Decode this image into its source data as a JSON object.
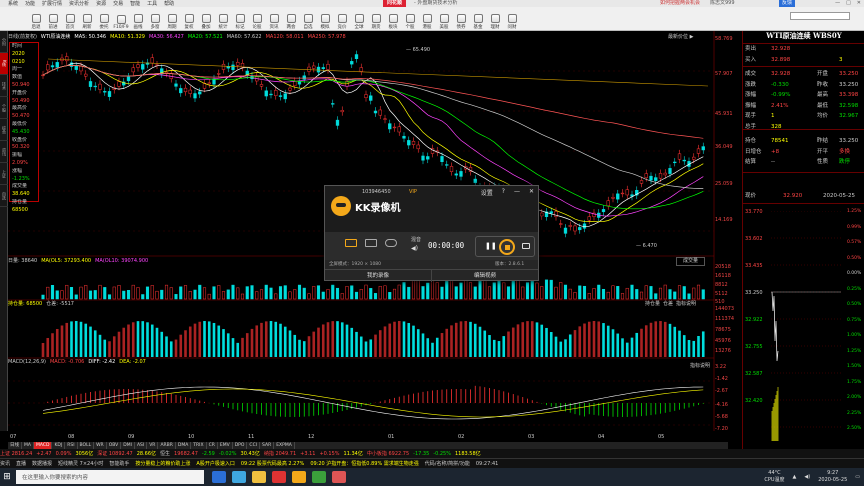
{
  "title_bar": {
    "menus": [
      "系统",
      "功能",
      "扩展行情",
      "资讯分析",
      "资源",
      "交易",
      "智能",
      "工具",
      "帮助"
    ],
    "brand": "同花顺",
    "subtitle": "- 外盘期货技术分析",
    "promo": "如何把握两会机会",
    "user": "陈志文999",
    "feedback": "反馈",
    "window_buttons": [
      "—",
      "□",
      "✕"
    ]
  },
  "toolbar": {
    "buttons": [
      "后退",
      "前进",
      "首页",
      "刷新",
      "委托",
      "F10/F9",
      "画线",
      "多窗",
      "周期",
      "复权",
      "叠加",
      "统计",
      "标记",
      "论股",
      "资讯",
      "两会",
      "自选",
      "模拟",
      "竞价",
      "全球",
      "期货",
      "板块",
      "个股",
      "港股",
      "美股",
      "债券",
      "基金",
      "理财",
      "问财"
    ]
  },
  "left_tabs": [
    "分时",
    "K线",
    "技术",
    "个股",
    "综合",
    "资讯",
    "上证",
    "自选"
  ],
  "main_chart": {
    "symbol_info": "日线(前复权)",
    "ma_strip": [
      {
        "label": "WTI原油连续",
        "color": "#ffffff"
      },
      {
        "label": "MA5: 50.346",
        "color": "#ffffff"
      },
      {
        "label": "MA10: 51.329",
        "color": "#ffff00"
      },
      {
        "label": "MA30: 56.427",
        "color": "#ff44ff"
      },
      {
        "label": "MA20: 57.521",
        "color": "#00ff00"
      },
      {
        "label": "MA60: 57.622",
        "color": "#cccccc"
      },
      {
        "label": "MA120: 58.011",
        "color": "#ff4444"
      },
      {
        "label": "MA250: 57.978",
        "color": "#ff4444"
      }
    ],
    "right_info": "最新价位 ▶",
    "price_axis": [
      "58.769",
      "57.907",
      "45.931",
      "36.049",
      "25.059",
      "14.169"
    ],
    "high_label": "65.490",
    "low_label": "6.470"
  },
  "data_window": [
    {
      "k": "时间",
      "v": "",
      "c": "w"
    },
    {
      "k": "",
      "v": "2020",
      "c": "y"
    },
    {
      "k": "",
      "v": "0210",
      "c": "y"
    },
    {
      "k": "周一",
      "v": "",
      "c": "w"
    },
    {
      "k": "数值",
      "v": "",
      "c": "w"
    },
    {
      "k": "",
      "v": "50.940",
      "c": "r"
    },
    {
      "k": "开盘价",
      "v": "",
      "c": "w"
    },
    {
      "k": "",
      "v": "50.490",
      "c": "r"
    },
    {
      "k": "最高价",
      "v": "",
      "c": "w"
    },
    {
      "k": "",
      "v": "50.470",
      "c": "r"
    },
    {
      "k": "最低价",
      "v": "",
      "c": "w"
    },
    {
      "k": "",
      "v": "45.430",
      "c": "g"
    },
    {
      "k": "收盘价",
      "v": "",
      "c": "w"
    },
    {
      "k": "",
      "v": "50.320",
      "c": "r"
    },
    {
      "k": "振幅",
      "v": "",
      "c": "w"
    },
    {
      "k": "",
      "v": "2.09%",
      "c": "r"
    },
    {
      "k": "涨幅",
      "v": "",
      "c": "w"
    },
    {
      "k": "",
      "v": "-1.23%",
      "c": "g"
    },
    {
      "k": "成交量",
      "v": "",
      "c": "w"
    },
    {
      "k": "",
      "v": "38.640",
      "c": "y"
    },
    {
      "k": "持仓量",
      "v": "",
      "c": "w"
    },
    {
      "k": "",
      "v": "68500",
      "c": "y"
    }
  ],
  "volume_panel": {
    "labels": [
      "日量: 38640",
      "MA(OL5: 37293.400",
      "MA(OL10: 39074.900"
    ],
    "axis": [
      "20518",
      "16118",
      "8812",
      "5112",
      "510"
    ],
    "dropdown": "成交量"
  },
  "oi_panel": {
    "labels": [
      "持仓量: 68500",
      "仓差: -5517"
    ],
    "axis": [
      "144073",
      "111374",
      "78675",
      "45976",
      "13276"
    ],
    "legend": [
      "持仓量",
      "仓差",
      "指标说明"
    ]
  },
  "macd_panel": {
    "labels": [
      "MACD(12,26,9)",
      "MACD: -0.706",
      "DIFF: -2.42",
      "DEA: -2.07"
    ],
    "axis": [
      "3.22",
      "-1.42",
      "-2.67",
      "-4.16",
      "-5.68",
      "-7.20"
    ],
    "help": "指标说明"
  },
  "time_axis": [
    "07",
    "08",
    "09",
    "10",
    "11",
    "12",
    "01",
    "02",
    "03",
    "04",
    "05"
  ],
  "bottom_tabs": [
    "日线",
    "MA",
    "MACD",
    "KDJ",
    "RSI",
    "BOLL",
    "WR",
    "OBV",
    "DMI",
    "ASI",
    "VR",
    "ARBR",
    "DMA",
    "TRIX",
    "CR",
    "EMV",
    "DPO",
    "CCI",
    "SAR",
    "EXPMA"
  ],
  "status_line_1": [
    {
      "t": "上证 2816.24",
      "c": "r"
    },
    {
      "t": "+2.47",
      "c": "r"
    },
    {
      "t": "0.09%",
      "c": "r"
    },
    {
      "t": "3056亿",
      "c": "y"
    },
    {
      "t": "深证 10892.47",
      "c": "r"
    },
    {
      "t": "28.66亿",
      "c": "y"
    },
    {
      "t": "恒生 ",
      "c": "w"
    },
    {
      "t": "19682.47",
      "c": "r"
    },
    {
      "t": "-2.59",
      "c": "g"
    },
    {
      "t": "-0.02%",
      "c": "g"
    },
    {
      "t": "30.43亿",
      "c": "y"
    },
    {
      "t": "纳指 2049.71",
      "c": "r"
    },
    {
      "t": "+3.11",
      "c": "r"
    },
    {
      "t": "+0.15%",
      "c": "r"
    },
    {
      "t": "11.34亿",
      "c": "y"
    },
    {
      "t": "中小板指 6922.75",
      "c": "r"
    },
    {
      "t": "-17.35",
      "c": "g"
    },
    {
      "t": "-0.25%",
      "c": "g"
    },
    {
      "t": "1183.58亿",
      "c": "y"
    }
  ],
  "status_line_2": [
    {
      "t": "资讯",
      "c": "w"
    },
    {
      "t": "直播",
      "c": "w"
    },
    {
      "t": "数据播报",
      "c": "w"
    },
    {
      "t": "短线精灵 7×24小时",
      "c": "w"
    },
    {
      "t": "智能助手",
      "c": "w"
    },
    {
      "t": "按分量稳上的粮价助上涨",
      "c": "y"
    },
    {
      "t": "A股开户极速入口",
      "c": "y"
    },
    {
      "t": "09:22 股票代码最高 2.27%",
      "c": "y"
    },
    {
      "t": "09:20 沪指开盘：恒指低0.89% 需求端生物走强",
      "c": "y"
    },
    {
      "t": "代码/名称/简拼/功能",
      "c": "w"
    },
    {
      "t": "09:27:41",
      "c": "w"
    }
  ],
  "taskbar": {
    "search_placeholder": "在这里输入你要搜索的内容",
    "tray_temp": "44°C",
    "tray_cpu": "CPU温度",
    "tray_time": "9:27",
    "tray_date": "2020-05-25"
  },
  "right_panel": {
    "title": "WTI原油连续 WBS0Y",
    "quotes": [
      {
        "l1": "卖出",
        "v1": "32.928",
        "c1": "r",
        "l2": "",
        "v2": "",
        "c2": "w"
      },
      {
        "l1": "买入",
        "v1": "32.898",
        "c1": "r",
        "l2": "",
        "v2": "3",
        "c2": "y"
      },
      {
        "l1": "成交",
        "v1": "32.928",
        "c1": "r",
        "l2": "开盘",
        "v2": "33.250",
        "c2": "r"
      },
      {
        "l1": "涨跌",
        "v1": "-0.330",
        "c1": "g",
        "l2": "昨收",
        "v2": "33.250",
        "c2": "w"
      },
      {
        "l1": "涨幅",
        "v1": "-0.99%",
        "c1": "g",
        "l2": "最高",
        "v2": "33.398",
        "c2": "r"
      },
      {
        "l1": "振幅",
        "v1": "2.41%",
        "c1": "r",
        "l2": "最低",
        "v2": "32.598",
        "c2": "g"
      },
      {
        "l1": "现手",
        "v1": "1",
        "c1": "y",
        "l2": "均价",
        "v2": "32.967",
        "c2": "g"
      },
      {
        "l1": "总手",
        "v1": "328",
        "c1": "y",
        "l2": "",
        "v2": "",
        "c2": "w"
      },
      {
        "l1": "持仓",
        "v1": "78541",
        "c1": "y",
        "l2": "昨结",
        "v2": "33.250",
        "c2": "w"
      },
      {
        "l1": "日增仓",
        "v1": "+8",
        "c1": "r",
        "l2": "开平",
        "v2": "多换",
        "c2": "r"
      },
      {
        "l1": "结算",
        "v1": "--",
        "c1": "w",
        "l2": "性质",
        "v2": "跌停",
        "c2": "g"
      }
    ],
    "tick_header": {
      "label": "现价",
      "value": "32.920",
      "date": "2020-05-25"
    },
    "tick_axis": [
      "33.770",
      "33.602",
      "33.435",
      "33.250",
      "32.922",
      "32.755",
      "32.587",
      "32.420"
    ],
    "tick_pct": [
      "1.25%",
      "0.99%",
      "0.57%",
      "0.50%",
      "0.00%",
      "0.25%",
      "0.50%",
      "0.75%",
      "1.00%",
      "1.25%",
      "1.50%",
      "1.75%",
      "2.00%",
      "2.25%",
      "2.50%"
    ],
    "tick_ref": "33.250"
  },
  "kk_recorder": {
    "account": "103946450",
    "vip": "VIP",
    "name": "KK录像机",
    "settings": "设置",
    "help": "?",
    "min": "—",
    "close": "✕",
    "audio": "混音",
    "timer": "00:00:00",
    "fullscreen_info": "全屏模式：1920 × 1080",
    "version": "版本：2.8.6.1",
    "my_recordings": "我的录像",
    "edit_video": "编辑视频"
  }
}
